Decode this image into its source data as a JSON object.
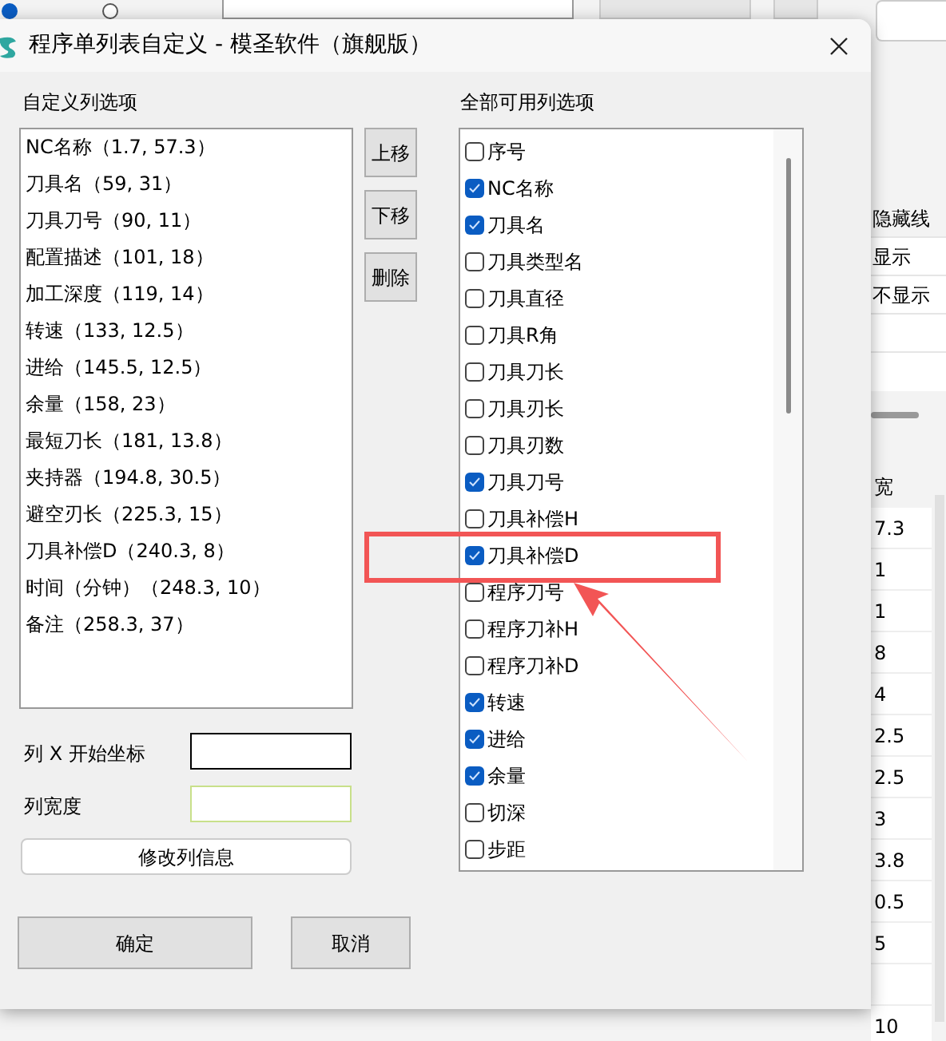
{
  "background": {
    "toolbar": {
      "radios": [
        {
          "selected": true
        },
        {
          "selected": false
        }
      ]
    },
    "side_rows": [
      "隐藏线",
      "显示",
      "不显示"
    ],
    "width_header": "宽",
    "width_values": [
      "7.3",
      "1",
      "1",
      "8",
      "4",
      "2.5",
      "2.5",
      "3",
      "3.8",
      "0.5",
      "5"
    ],
    "bottom_width_value": "10"
  },
  "window": {
    "title": "程序单列表自定义 - 模圣软件（旗舰版）"
  },
  "custom_columns": {
    "label": "自定义列选项",
    "items": [
      "NC名称（1.7, 57.3）",
      "刀具名（59, 31）",
      "刀具刀号（90, 11）",
      "配置描述（101, 18）",
      "加工深度（119, 14）",
      "转速（133, 12.5）",
      "进给（145.5, 12.5）",
      "余量（158, 23）",
      "最短刀长（181, 13.8）",
      "夹持器（194.8, 30.5）",
      "避空刃长（225.3, 15）",
      "刀具补偿D（240.3, 8）",
      "时间（分钟）（248.3, 10）",
      "备注（258.3, 37）"
    ]
  },
  "side_buttons": [
    "上移",
    "下移",
    "删除"
  ],
  "available_columns": {
    "label": "全部可用列选项",
    "items": [
      {
        "label": "序号",
        "checked": false,
        "highlighted": false
      },
      {
        "label": "NC名称",
        "checked": true,
        "highlighted": false
      },
      {
        "label": "刀具名",
        "checked": true,
        "highlighted": false
      },
      {
        "label": "刀具类型名",
        "checked": false,
        "highlighted": false
      },
      {
        "label": "刀具直径",
        "checked": false,
        "highlighted": false
      },
      {
        "label": "刀具R角",
        "checked": false,
        "highlighted": false
      },
      {
        "label": "刀具刀长",
        "checked": false,
        "highlighted": false
      },
      {
        "label": "刀具刃长",
        "checked": false,
        "highlighted": false
      },
      {
        "label": "刀具刃数",
        "checked": false,
        "highlighted": false
      },
      {
        "label": "刀具刀号",
        "checked": true,
        "highlighted": false
      },
      {
        "label": "刀具补偿H",
        "checked": false,
        "highlighted": false
      },
      {
        "label": "刀具补偿D",
        "checked": true,
        "highlighted": true
      },
      {
        "label": "程序刀号",
        "checked": false,
        "highlighted": false
      },
      {
        "label": "程序刀补H",
        "checked": false,
        "highlighted": false
      },
      {
        "label": "程序刀补D",
        "checked": false,
        "highlighted": false
      },
      {
        "label": "转速",
        "checked": true,
        "highlighted": false
      },
      {
        "label": "进给",
        "checked": true,
        "highlighted": false
      },
      {
        "label": "余量",
        "checked": true,
        "highlighted": false
      },
      {
        "label": "切深",
        "checked": false,
        "highlighted": false
      },
      {
        "label": "步距",
        "checked": false,
        "highlighted": false
      }
    ]
  },
  "fields": [
    {
      "label": "列 X 开始坐标"
    },
    {
      "label": "列宽度"
    }
  ],
  "modify_button": "修改列信息",
  "buttons": [
    "确定",
    "取消"
  ]
}
